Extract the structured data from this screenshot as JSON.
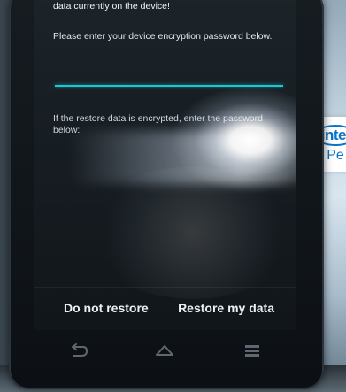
{
  "screen": {
    "line1": "allow the operation to proceed. This will replace any data currently on the device!",
    "line2": "Please enter your device encryption password below.",
    "line3": "If the restore data is encrypted, enter the password below:"
  },
  "actions": {
    "do_not_restore": "Do not restore",
    "restore_my_data": "Restore my data"
  },
  "icons": {
    "back": "back-icon",
    "home": "home-icon",
    "recents": "recents-icon"
  },
  "colors": {
    "accent": "#1ec7d6",
    "text": "#e6eef4"
  },
  "laptop_logo": {
    "line1": "intel",
    "line2": "Pe"
  }
}
